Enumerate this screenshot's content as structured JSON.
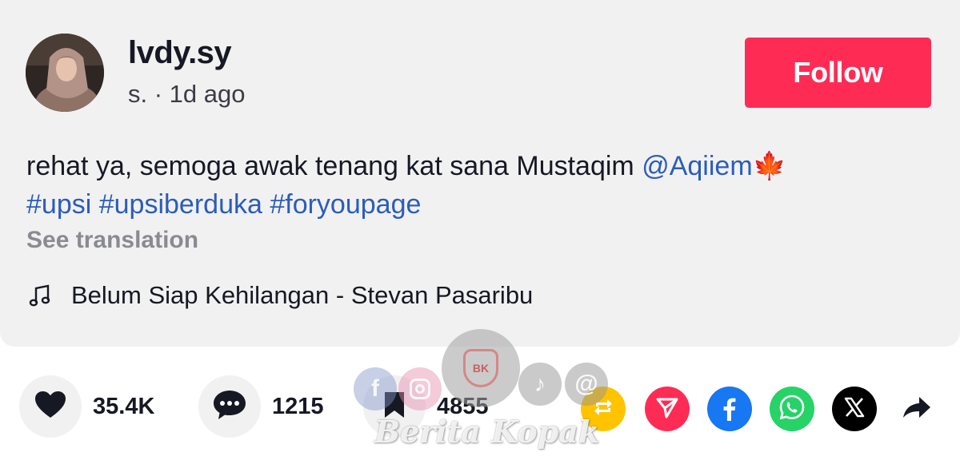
{
  "post": {
    "username": "lvdy.sy",
    "subline": "s. · 1d ago",
    "follow_label": "Follow",
    "caption_text": "rehat ya, semoga awak tenang kat sana Mustaqim ",
    "mention": "@Aqiiem",
    "maple_emoji": "🍁",
    "hashtags": [
      "#upsi",
      "#upsiberduka",
      "#foryoupage"
    ],
    "see_translation": "See translation",
    "music_title": "Belum Siap Kehilangan - Stevan Pasaribu"
  },
  "actions": {
    "likes": "35.4K",
    "comments": "1215",
    "saves": "4855"
  },
  "share_icons": [
    "repost-icon",
    "send-icon",
    "facebook-icon",
    "whatsapp-icon",
    "x-icon",
    "share-arrow-icon"
  ],
  "colors": {
    "follow": "#fe2c55",
    "link": "#2b5db9",
    "repost": "#ffc300",
    "send": "#fe2c55",
    "facebook": "#1877f2",
    "whatsapp": "#25d366",
    "x": "#000000"
  },
  "watermark": {
    "badge": "BK",
    "text": "Berita Kopak"
  }
}
